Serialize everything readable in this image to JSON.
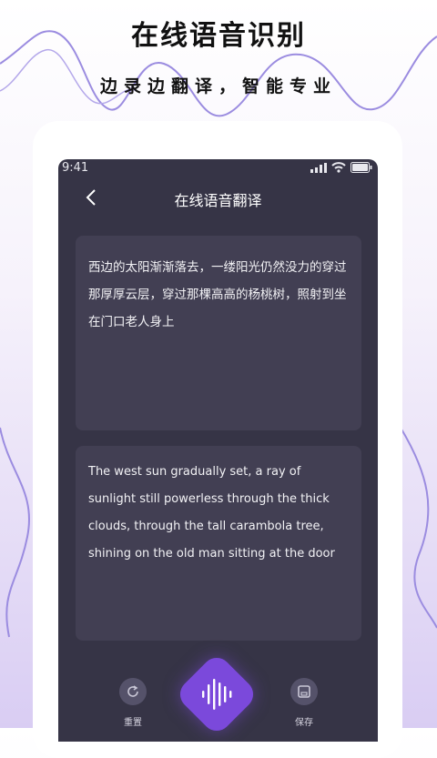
{
  "promo": {
    "title": "在线语音识别",
    "subtitle": "边录边翻译，智能专业"
  },
  "status_bar": {
    "time": "9:41"
  },
  "nav": {
    "back_icon": "chevron-left-icon",
    "title": "在线语音翻译"
  },
  "source_text": "西边的太阳渐渐落去，一缕阳光仍然没力的穿过那厚厚云层，穿过那棵高高的杨桃树，照射到坐在门口老人身上",
  "translated_text": "The west sun gradually set, a ray of sunlight still powerless through the thick clouds, through the tall carambola tree, shining on the old man sitting at the door",
  "controls": {
    "reset_label": "重置",
    "save_label": "保存",
    "record_icon": "soundwave-icon"
  },
  "colors": {
    "screen_bg": "#363446",
    "card_bg": "#423f53",
    "accent": "#7b49db"
  }
}
